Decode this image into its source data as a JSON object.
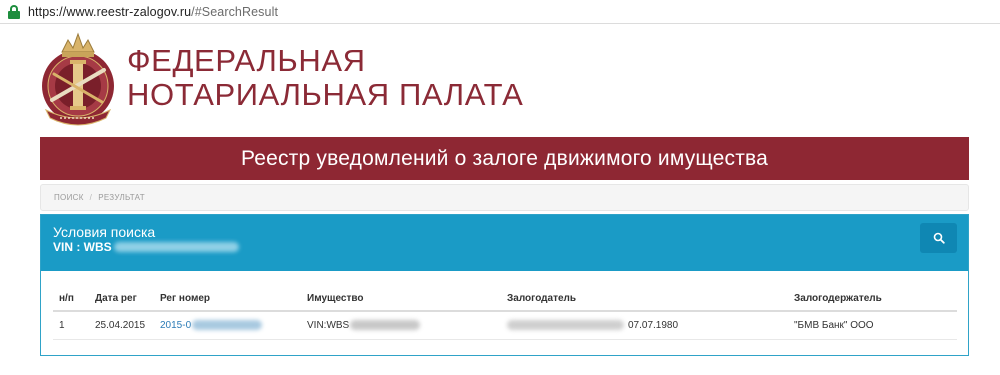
{
  "browser": {
    "url_scheme": "https://",
    "url_host": "www.reestr-zalogov.ru",
    "url_fragment": "/#SearchResult"
  },
  "header": {
    "brand_line1": "ФЕДЕРАЛЬНАЯ",
    "brand_line2": "НОТАРИАЛЬНАЯ ПАЛАТА",
    "logo_icon": "notary-chamber-emblem"
  },
  "banner": {
    "title": "Реестр уведомлений о залоге движимого имущества"
  },
  "breadcrumb": {
    "items": [
      "ПОИСК",
      "РЕЗУЛЬТАТ"
    ],
    "separator": "/"
  },
  "search_panel": {
    "title": "Условия поиска",
    "vin_label": "VIN : WBS",
    "search_icon": "search-icon"
  },
  "results": {
    "columns": [
      "н/п",
      "Дата рег",
      "Рег номер",
      "Имущество",
      "Залогодатель",
      "Залогодержатель"
    ],
    "rows": [
      {
        "num": "1",
        "date": "25.04.2015",
        "reg_number": "2015-0",
        "property": "VIN:WBS",
        "pledgor": "07.07.1980",
        "pledgee": "\"БМВ Банк\" ООО"
      }
    ]
  },
  "colors": {
    "brand": "#8e2733",
    "panel": "#1a9bc6",
    "link": "#2b7bb6"
  }
}
